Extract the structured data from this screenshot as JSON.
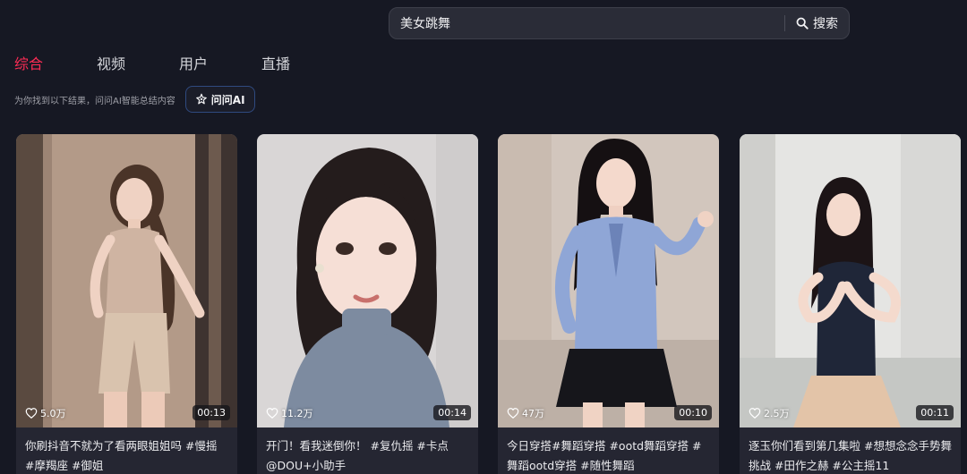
{
  "search": {
    "value": "美女跳舞",
    "button_label": "搜索",
    "icon": "search-icon"
  },
  "tabs": [
    {
      "label": "综合",
      "active": true
    },
    {
      "label": "视频",
      "active": false
    },
    {
      "label": "用户",
      "active": false
    },
    {
      "label": "直播",
      "active": false
    }
  ],
  "ai": {
    "hint": "为你找到以下结果，问问AI智能总结内容",
    "button_label": "问问AI",
    "icon": "ai-sparkle-icon"
  },
  "colors": {
    "accent": "#fe2c55",
    "background": "#161823",
    "card": "#252632"
  },
  "videos": [
    {
      "likes": "5.0万",
      "duration": "00:13",
      "caption": "你刷抖音不就为了看两眼姐姐吗 #慢摇 #摩羯座 #御姐"
    },
    {
      "likes": "11.2万",
      "duration": "00:14",
      "caption": "开门！看我迷倒你！ #复仇摇 #卡点 @DOU+小助手"
    },
    {
      "likes": "47万",
      "duration": "00:10",
      "caption": "今日穿搭#舞蹈穿搭 #ootd舞蹈穿搭 #舞蹈ootd穿搭 #随性舞蹈"
    },
    {
      "likes": "2.5万",
      "duration": "00:11",
      "caption": "逐玉你们看到第几集啦 #想想念念手势舞挑战 #田作之赫 #公主摇11"
    }
  ]
}
